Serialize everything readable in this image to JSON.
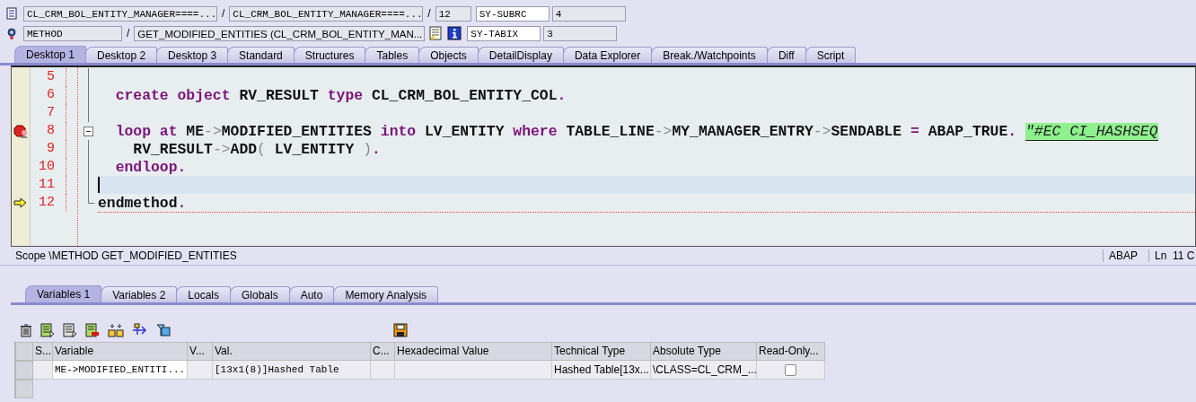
{
  "header": {
    "row1": {
      "program": "CL_CRM_BOL_ENTITY_MANAGER====...",
      "include": "CL_CRM_BOL_ENTITY_MANAGER====...",
      "line": "12",
      "sysvar": "SY-SUBRC",
      "sysval": "4"
    },
    "row2": {
      "kind": "METHOD",
      "event": "GET_MODIFIED_ENTITIES (CL_CRM_BOL_ENTITY_MAN...",
      "sysvar": "SY-TABIX",
      "sysval": "3"
    },
    "separator": "/"
  },
  "tabs": [
    {
      "label": "Desktop 1",
      "selected": true
    },
    {
      "label": "Desktop 2",
      "selected": false
    },
    {
      "label": "Desktop 3",
      "selected": false
    },
    {
      "label": "Standard",
      "selected": false
    },
    {
      "label": "Structures",
      "selected": false
    },
    {
      "label": "Tables",
      "selected": false
    },
    {
      "label": "Objects",
      "selected": false
    },
    {
      "label": "DetailDisplay",
      "selected": false
    },
    {
      "label": "Data Explorer",
      "selected": false
    },
    {
      "label": "Break./Watchpoints",
      "selected": false
    },
    {
      "label": "Diff",
      "selected": false
    },
    {
      "label": "Script",
      "selected": false
    }
  ],
  "editor": {
    "lines": [
      {
        "number": "5",
        "kind": "statement",
        "breakpoint": false,
        "current_statement": false,
        "highlighted": false
      },
      {
        "number": "6",
        "kind": "statement",
        "breakpoint": false,
        "current_statement": false,
        "highlighted": false,
        "tokens": [
          {
            "text": "  create object",
            "kind": "kw"
          },
          {
            "text": " RV_RESULT ",
            "kind": "id"
          },
          {
            "text": "type",
            "kind": "kw"
          },
          {
            "text": " CL_CRM_BOL_ENTITY_COL",
            "kind": "id"
          },
          {
            "text": ".",
            "kind": "kw"
          }
        ]
      },
      {
        "number": "7",
        "kind": "statement",
        "breakpoint": false,
        "current_statement": false,
        "highlighted": false
      },
      {
        "number": "8",
        "kind": "block_start",
        "breakpoint": true,
        "current_statement": false,
        "highlighted": false,
        "tokens": [
          {
            "text": "  loop at",
            "kind": "kw"
          },
          {
            "text": " ME",
            "kind": "id"
          },
          {
            "text": "->",
            "kind": "op"
          },
          {
            "text": "MODIFIED_ENTITIES ",
            "kind": "id"
          },
          {
            "text": "into",
            "kind": "kw"
          },
          {
            "text": " LV_ENTITY ",
            "kind": "id"
          },
          {
            "text": "where",
            "kind": "kw"
          },
          {
            "text": " TABLE_LINE",
            "kind": "id"
          },
          {
            "text": "->",
            "kind": "op"
          },
          {
            "text": "MY_MANAGER_ENTRY",
            "kind": "id"
          },
          {
            "text": "->",
            "kind": "op"
          },
          {
            "text": "SENDABLE ",
            "kind": "id"
          },
          {
            "text": "=",
            "kind": "kw"
          },
          {
            "text": " ABAP_TRUE",
            "kind": "id"
          },
          {
            "text": ". ",
            "kind": "kw"
          },
          {
            "text": "\"#EC CI_HASHSEQ",
            "kind": "comment"
          }
        ]
      },
      {
        "number": "9",
        "kind": "statement",
        "breakpoint": false,
        "current_statement": false,
        "highlighted": false,
        "tokens": [
          {
            "text": "    RV_RESULT",
            "kind": "id"
          },
          {
            "text": "->",
            "kind": "op"
          },
          {
            "text": "ADD",
            "kind": "id"
          },
          {
            "text": "( ",
            "kind": "op"
          },
          {
            "text": "LV_ENTITY ",
            "kind": "id"
          },
          {
            "text": ")",
            "kind": "op"
          },
          {
            "text": ".",
            "kind": "kw"
          }
        ]
      },
      {
        "number": "10",
        "kind": "statement",
        "breakpoint": false,
        "current_statement": false,
        "highlighted": false,
        "tokens": [
          {
            "text": "  endloop.",
            "kind": "kw"
          }
        ]
      },
      {
        "number": "11",
        "kind": "statement",
        "breakpoint": false,
        "current_statement": false,
        "highlighted": true
      },
      {
        "number": "12",
        "kind": "block_end",
        "breakpoint": false,
        "current_statement": true,
        "highlighted": false,
        "tokens": [
          {
            "text": "endmethod",
            "kind": "id"
          },
          {
            "text": ".",
            "kind": "kw"
          }
        ]
      }
    ]
  },
  "status_bar": {
    "scope": "Scope \\METHOD GET_MODIFIED_ENTITIES",
    "language": "ABAP",
    "position": "Ln  11 C"
  },
  "bottom_tabs": [
    {
      "label": "Variables 1",
      "selected": true
    },
    {
      "label": "Variables 2",
      "selected": false
    },
    {
      "label": "Locals",
      "selected": false
    },
    {
      "label": "Globals",
      "selected": false
    },
    {
      "label": "Auto",
      "selected": false
    },
    {
      "label": "Memory Analysis",
      "selected": false
    }
  ],
  "table": {
    "columns": [
      "S...",
      "Variable",
      "V...",
      "Val.",
      "C...",
      "Hexadecimal Value",
      "Technical Type",
      "Absolute Type",
      "Read-Only..."
    ],
    "rows": [
      {
        "cells": [
          "",
          "ME->MODIFIED_ENTITI...",
          "",
          "[13x1(8)]Hashed Table",
          "",
          "",
          "Hashed Table[13x...",
          "\\CLASS=CL_CRM_...",
          ""
        ],
        "read_only": false
      }
    ]
  }
}
